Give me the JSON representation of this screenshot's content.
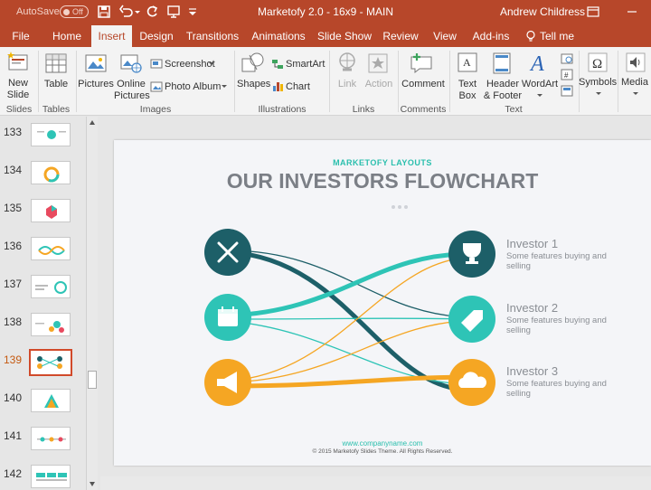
{
  "titlebar": {
    "autosave": "AutoSave",
    "toggle_state": "Off",
    "title": "Marketofy 2.0 - 16x9 - MAIN",
    "user": "Andrew Childress"
  },
  "tabs": [
    {
      "label": "File"
    },
    {
      "label": "Home"
    },
    {
      "label": "Insert"
    },
    {
      "label": "Design"
    },
    {
      "label": "Transitions"
    },
    {
      "label": "Animations"
    },
    {
      "label": "Slide Show"
    },
    {
      "label": "Review"
    },
    {
      "label": "View"
    },
    {
      "label": "Add-ins"
    },
    {
      "label": "Tell me"
    }
  ],
  "ribbon": {
    "new_slide": "New\nSlide",
    "table": "Table",
    "pictures": "Pictures",
    "online_pictures": "Online\nPictures",
    "screenshot": "Screenshot",
    "photo_album": "Photo Album",
    "shapes": "Shapes",
    "smartart": "SmartArt",
    "chart": "Chart",
    "link": "Link",
    "action": "Action",
    "comment": "Comment",
    "text_box": "Text\nBox",
    "header_footer": "Header\n& Footer",
    "wordart": "WordArt",
    "symbols": "Symbols",
    "media": "Media",
    "groups": {
      "slides": "Slides",
      "tables": "Tables",
      "images": "Images",
      "illustrations": "Illustrations",
      "links": "Links",
      "comments": "Comments",
      "text": "Text"
    }
  },
  "thumbnails": [
    {
      "number": "133"
    },
    {
      "number": "134"
    },
    {
      "number": "135"
    },
    {
      "number": "136"
    },
    {
      "number": "137"
    },
    {
      "number": "138"
    },
    {
      "number": "139"
    },
    {
      "number": "140"
    },
    {
      "number": "141"
    },
    {
      "number": "142"
    }
  ],
  "selected_slide": "139",
  "slide": {
    "subtitle": "MARKETOFY LAYOUTS",
    "title": "OUR INVESTORS FLOWCHART",
    "investors": [
      {
        "name": "Investor 1",
        "desc": "Some features buying and selling"
      },
      {
        "name": "Investor 2",
        "desc": "Some features buying and selling"
      },
      {
        "name": "Investor 3",
        "desc": "Some features buying and selling"
      }
    ],
    "website": "www.companyname.com",
    "copyright": "© 2015 Marketofy Slides Theme. All Rights Reserved."
  },
  "colors": {
    "accent": "#b7472a",
    "dark_teal": "#1d5f68",
    "teal": "#2ec4b6",
    "orange": "#f5a623"
  },
  "icons": {
    "left_nodes": [
      "tools-icon",
      "calendar-icon",
      "megaphone-icon"
    ],
    "right_nodes": [
      "trophy-icon",
      "tag-icon",
      "cloud-icon"
    ]
  }
}
